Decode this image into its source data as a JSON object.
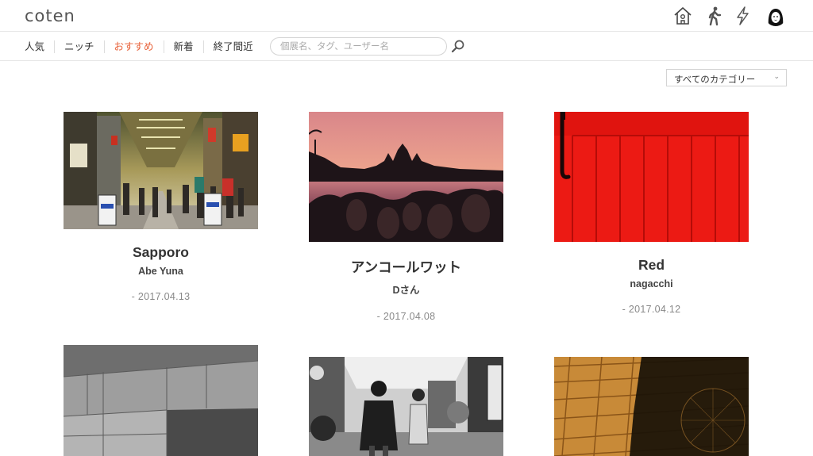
{
  "brand": {
    "logo_text": "coten"
  },
  "header_icons": {
    "home": "home-icon",
    "walk": "walking-person-icon",
    "activity": "lightning-icon",
    "profile": "avatar"
  },
  "nav": {
    "tabs": [
      {
        "label": "人気"
      },
      {
        "label": "ニッチ"
      },
      {
        "label": "おすすめ",
        "active": true
      },
      {
        "label": "新着"
      },
      {
        "label": "終了間近"
      }
    ]
  },
  "search": {
    "placeholder": "個展名、タグ、ユーザー名",
    "value": ""
  },
  "category": {
    "selected": "すべてのカテゴリー"
  },
  "colors": {
    "accent": "#e8623a",
    "text": "#333333",
    "muted": "#888888",
    "border": "#e6e6e6"
  },
  "exhibitions": [
    {
      "title": "Sapporo",
      "author": "Abe Yuna",
      "date": "- 2017.04.13"
    },
    {
      "title": "アンコールワット",
      "author": "Dさん",
      "date": "- 2017.04.08"
    },
    {
      "title": "Red",
      "author": "nagacchi",
      "date": "- 2017.04.12"
    },
    {
      "title": "",
      "author": "",
      "date": ""
    },
    {
      "title": "",
      "author": "",
      "date": ""
    },
    {
      "title": "",
      "author": "",
      "date": ""
    }
  ]
}
